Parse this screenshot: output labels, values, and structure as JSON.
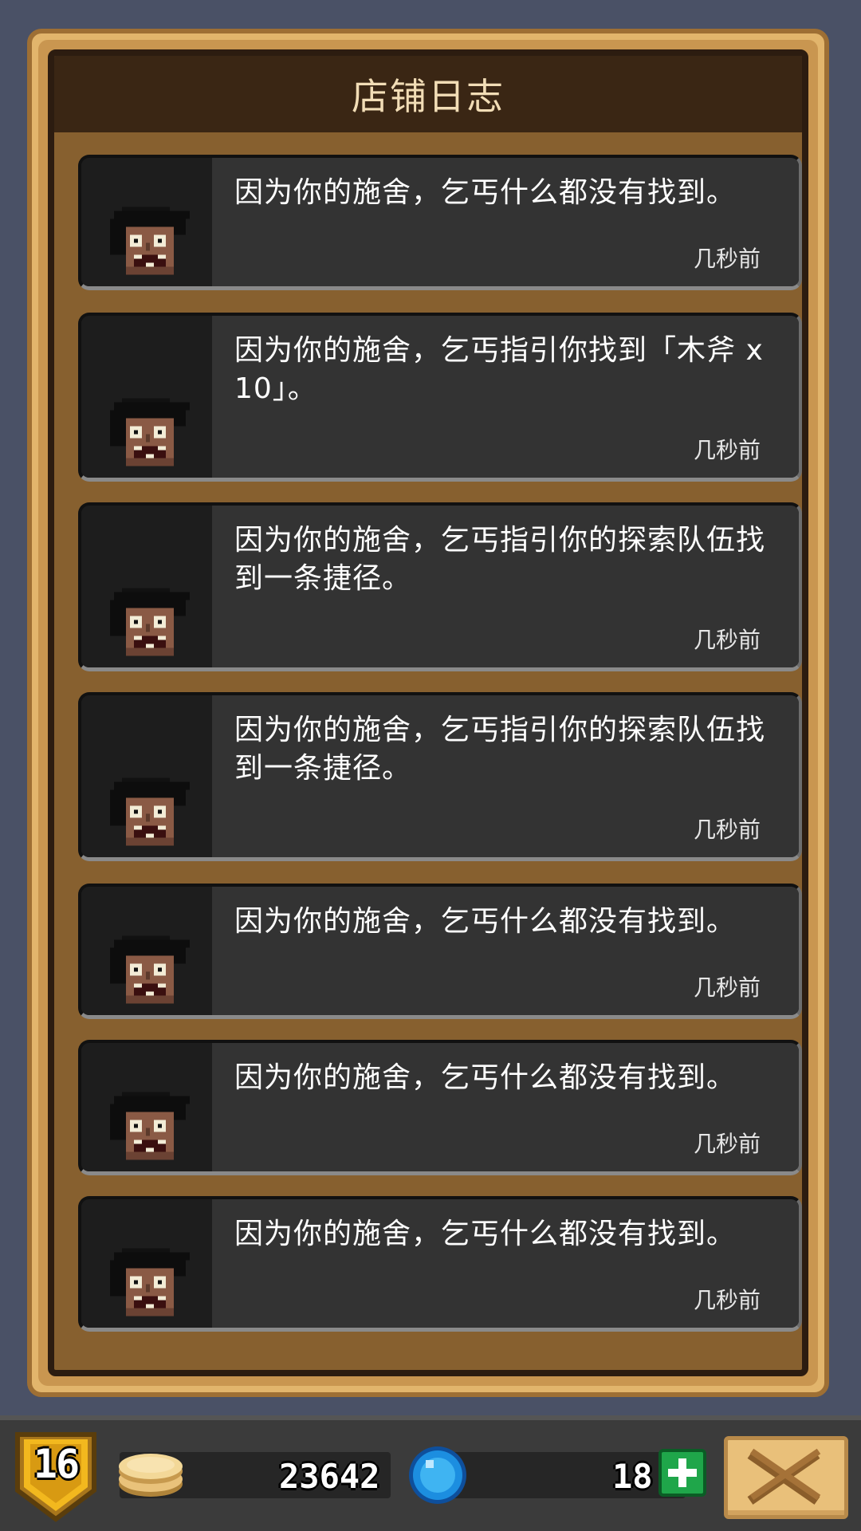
{
  "dialog": {
    "title": "店铺日志"
  },
  "log_entries": [
    {
      "message": "因为你的施舍，乞丐什么都没有找到。",
      "time": "几秒前",
      "avatar": "beggar-icon"
    },
    {
      "message": "因为你的施舍，乞丐指引你找到「木斧 x 10」。",
      "time": "几秒前",
      "avatar": "beggar-icon"
    },
    {
      "message": "因为你的施舍，乞丐指引你的探索队伍找到一条捷径。",
      "time": "几秒前",
      "avatar": "beggar-icon"
    },
    {
      "message": "因为你的施舍，乞丐指引你的探索队伍找到一条捷径。",
      "time": "几秒前",
      "avatar": "beggar-icon"
    },
    {
      "message": "因为你的施舍，乞丐什么都没有找到。",
      "time": "几秒前",
      "avatar": "beggar-icon"
    },
    {
      "message": "因为你的施舍，乞丐什么都没有找到。",
      "time": "几秒前",
      "avatar": "beggar-icon"
    },
    {
      "message": "因为你的施舍，乞丐什么都没有找到。",
      "time": "几秒前",
      "avatar": "beggar-icon"
    }
  ],
  "status_bar": {
    "level": "16",
    "gold": "23642",
    "gems": "18",
    "icons": {
      "level": "shield-badge-icon",
      "gold": "gold-coins-icon",
      "gems": "blue-gem-icon",
      "add": "plus-icon",
      "close": "close-x-icon"
    }
  },
  "colors": {
    "background": "#4a5166",
    "frame_gold": "#e2b56c",
    "panel_brown": "#87602f",
    "title_bar": "#3a2614",
    "card": "#333333",
    "add_button": "#1fa64a"
  }
}
